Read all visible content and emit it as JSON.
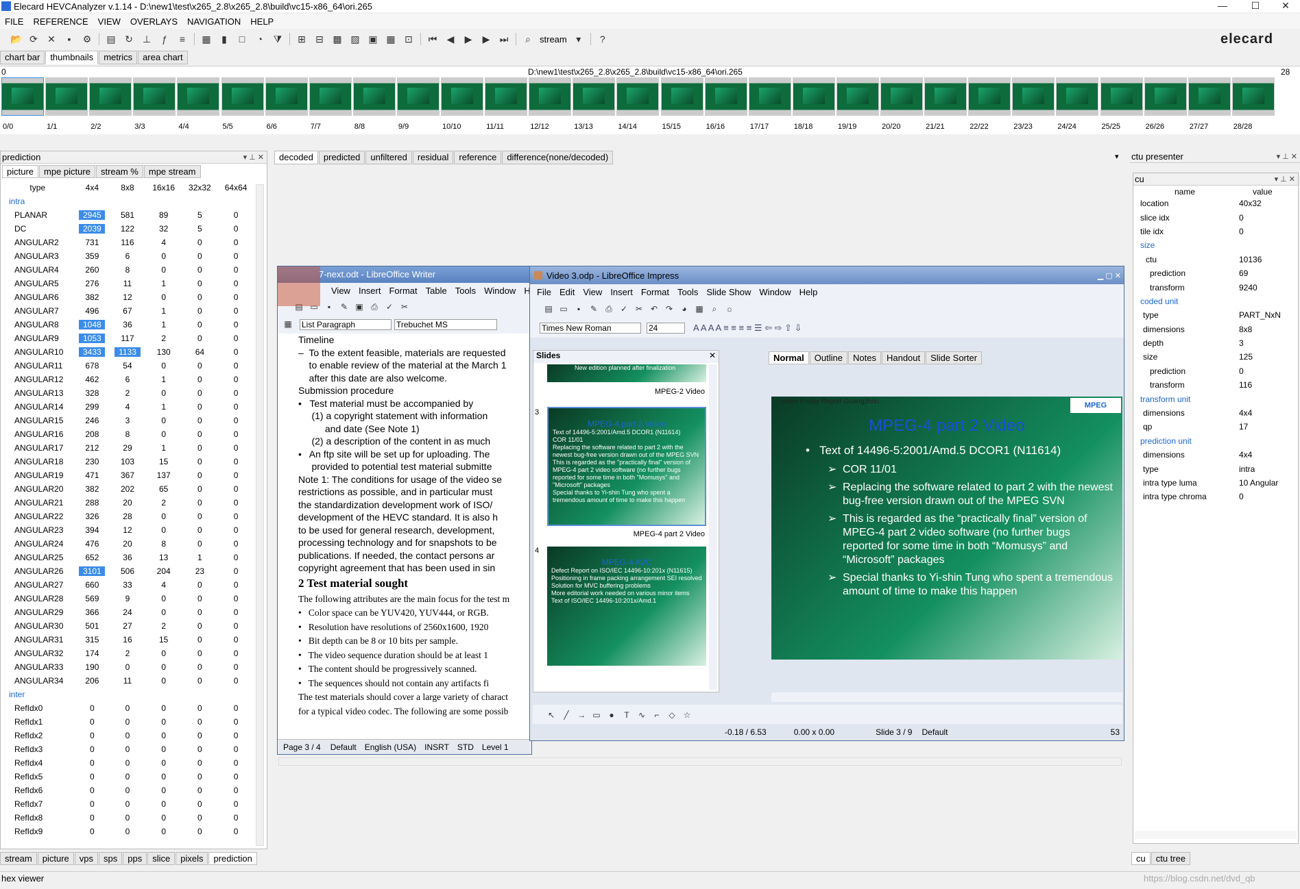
{
  "window": {
    "title": "Elecard HEVCAnalyzer v.1.14 - D:\\new1\\test\\x265_2.8\\x265_2.8\\build\\vc15-x86_64\\ori.265",
    "min": "—",
    "max": "☐",
    "close": "✕"
  },
  "menu": [
    "FILE",
    "REFERENCE",
    "VIEW",
    "OVERLAYS",
    "NAVIGATION",
    "HELP"
  ],
  "toolbar": {
    "stream_label": "stream",
    "help": "?",
    "logo": "elecard"
  },
  "viewtabs": [
    "chart bar",
    "thumbnails",
    "metrics",
    "area chart"
  ],
  "thumbs": {
    "path": "D:\\new1\\test\\x265_2.8\\x265_2.8\\build\\vc15-x86_64\\ori.265",
    "left": "0",
    "right": "28",
    "labels": [
      "0/0",
      "1/1",
      "2/2",
      "3/3",
      "4/4",
      "5/5",
      "6/6",
      "7/7",
      "8/8",
      "9/9",
      "10/10",
      "11/11",
      "12/12",
      "13/13",
      "14/14",
      "15/15",
      "16/16",
      "17/17",
      "18/18",
      "19/19",
      "20/20",
      "21/21",
      "22/22",
      "23/23",
      "24/24",
      "25/25",
      "26/26",
      "27/27",
      "28/28"
    ]
  },
  "prediction": {
    "title": "prediction",
    "tabs": [
      "picture",
      "mpe picture",
      "stream %",
      "mpe stream"
    ],
    "headers": [
      "type",
      "4x4",
      "8x8",
      "16x16",
      "32x32",
      "64x64"
    ],
    "intra_label": "intra",
    "inter_label": "inter",
    "intra": [
      [
        "PLANAR",
        "2945",
        "581",
        "89",
        "5",
        "0"
      ],
      [
        "DC",
        "2039",
        "122",
        "32",
        "5",
        "0"
      ],
      [
        "ANGULAR2",
        "731",
        "116",
        "4",
        "0",
        "0"
      ],
      [
        "ANGULAR3",
        "359",
        "6",
        "0",
        "0",
        "0"
      ],
      [
        "ANGULAR4",
        "260",
        "8",
        "0",
        "0",
        "0"
      ],
      [
        "ANGULAR5",
        "276",
        "11",
        "1",
        "0",
        "0"
      ],
      [
        "ANGULAR6",
        "382",
        "12",
        "0",
        "0",
        "0"
      ],
      [
        "ANGULAR7",
        "496",
        "67",
        "1",
        "0",
        "0"
      ],
      [
        "ANGULAR8",
        "1048",
        "36",
        "1",
        "0",
        "0"
      ],
      [
        "ANGULAR9",
        "1053",
        "117",
        "2",
        "0",
        "0"
      ],
      [
        "ANGULAR10",
        "3433",
        "1133",
        "130",
        "64",
        "0"
      ],
      [
        "ANGULAR11",
        "678",
        "54",
        "0",
        "0",
        "0"
      ],
      [
        "ANGULAR12",
        "462",
        "6",
        "1",
        "0",
        "0"
      ],
      [
        "ANGULAR13",
        "328",
        "2",
        "0",
        "0",
        "0"
      ],
      [
        "ANGULAR14",
        "299",
        "4",
        "1",
        "0",
        "0"
      ],
      [
        "ANGULAR15",
        "246",
        "3",
        "0",
        "0",
        "0"
      ],
      [
        "ANGULAR16",
        "208",
        "8",
        "0",
        "0",
        "0"
      ],
      [
        "ANGULAR17",
        "212",
        "29",
        "1",
        "0",
        "0"
      ],
      [
        "ANGULAR18",
        "230",
        "103",
        "15",
        "0",
        "0"
      ],
      [
        "ANGULAR19",
        "471",
        "367",
        "137",
        "0",
        "0"
      ],
      [
        "ANGULAR20",
        "382",
        "202",
        "65",
        "0",
        "0"
      ],
      [
        "ANGULAR21",
        "288",
        "20",
        "2",
        "0",
        "0"
      ],
      [
        "ANGULAR22",
        "326",
        "28",
        "0",
        "0",
        "0"
      ],
      [
        "ANGULAR23",
        "394",
        "12",
        "0",
        "0",
        "0"
      ],
      [
        "ANGULAR24",
        "476",
        "20",
        "8",
        "0",
        "0"
      ],
      [
        "ANGULAR25",
        "652",
        "36",
        "13",
        "1",
        "0"
      ],
      [
        "ANGULAR26",
        "3101",
        "506",
        "204",
        "23",
        "0"
      ],
      [
        "ANGULAR27",
        "660",
        "33",
        "4",
        "0",
        "0"
      ],
      [
        "ANGULAR28",
        "569",
        "9",
        "0",
        "0",
        "0"
      ],
      [
        "ANGULAR29",
        "366",
        "24",
        "0",
        "0",
        "0"
      ],
      [
        "ANGULAR30",
        "501",
        "27",
        "2",
        "0",
        "0"
      ],
      [
        "ANGULAR31",
        "315",
        "16",
        "15",
        "0",
        "0"
      ],
      [
        "ANGULAR32",
        "174",
        "2",
        "0",
        "0",
        "0"
      ],
      [
        "ANGULAR33",
        "190",
        "0",
        "0",
        "0",
        "0"
      ],
      [
        "ANGULAR34",
        "206",
        "11",
        "0",
        "0",
        "0"
      ]
    ],
    "inter": [
      [
        "RefIdx0",
        "0",
        "0",
        "0",
        "0",
        "0"
      ],
      [
        "RefIdx1",
        "0",
        "0",
        "0",
        "0",
        "0"
      ],
      [
        "RefIdx2",
        "0",
        "0",
        "0",
        "0",
        "0"
      ],
      [
        "RefIdx3",
        "0",
        "0",
        "0",
        "0",
        "0"
      ],
      [
        "RefIdx4",
        "0",
        "0",
        "0",
        "0",
        "0"
      ],
      [
        "RefIdx5",
        "0",
        "0",
        "0",
        "0",
        "0"
      ],
      [
        "RefIdx6",
        "0",
        "0",
        "0",
        "0",
        "0"
      ],
      [
        "RefIdx7",
        "0",
        "0",
        "0",
        "0",
        "0"
      ],
      [
        "RefIdx8",
        "0",
        "0",
        "0",
        "0",
        "0"
      ],
      [
        "RefIdx9",
        "0",
        "0",
        "0",
        "0",
        "0"
      ]
    ],
    "bottom_tabs": [
      "stream",
      "picture",
      "vps",
      "sps",
      "pps",
      "slice",
      "pixels",
      "prediction"
    ]
  },
  "center_tabs": [
    "decoded",
    "predicted",
    "unfiltered",
    "residual",
    "reference",
    "difference(none/decoded)"
  ],
  "ctu": {
    "title": "ctu presenter",
    "sub": "cu",
    "headers": [
      "name",
      "value"
    ],
    "rows": [
      [
        "location",
        "40x32",
        0
      ],
      [
        "slice idx",
        "0",
        0
      ],
      [
        "tile idx",
        "0",
        0
      ],
      [
        "size",
        "",
        2
      ],
      [
        "ctu",
        "10136",
        1
      ],
      [
        "prediction",
        "69",
        2
      ],
      [
        "transform",
        "9240",
        2
      ],
      [
        "coded unit",
        "",
        3
      ],
      [
        "type",
        "PART_NxN",
        1
      ],
      [
        "dimensions",
        "8x8",
        1
      ],
      [
        "depth",
        "3",
        1
      ],
      [
        "size",
        "125",
        1
      ],
      [
        "prediction",
        "0",
        2
      ],
      [
        "transform",
        "116",
        2
      ],
      [
        "transform unit",
        "",
        3
      ],
      [
        "dimensions",
        "4x4",
        1
      ],
      [
        "qp",
        "17",
        1
      ],
      [
        "prediction unit",
        "",
        3
      ],
      [
        "dimensions",
        "4x4",
        1
      ],
      [
        "type",
        "intra",
        1
      ],
      [
        "intra type luma",
        "10 Angular",
        1
      ],
      [
        "intra type chroma",
        "0",
        1
      ]
    ],
    "bottom_tabs": [
      "cu",
      "ctu tree"
    ]
  },
  "hexviewer": "hex viewer",
  "watermark": "https://blog.csdn.net/dvd_qb",
  "writer": {
    "title": "7-next.odt - LibreOffice Writer",
    "menu": [
      "View",
      "Insert",
      "Format",
      "Table",
      "Tools",
      "Window",
      "Help"
    ],
    "style": "List Paragraph",
    "font": "Trebuchet MS",
    "lines": [
      "Timeline",
      "–  To the extent feasible, materials are requested",
      "    to enable review of the material at the March 1",
      "    after this date are also welcome.",
      "Submission procedure",
      "•   Test material must be accompanied by",
      "     (1) a copyright statement with information",
      "          and date (See Note 1)",
      "     (2) a description of the content in as much",
      "•   An ftp site will be set up for uploading. The",
      "     provided to potential test material submitte",
      "Note 1: The conditions for usage of the video se",
      "restrictions as possible, and in particular must",
      "the standardization development work of ISO/",
      "development of the HEVC standard. It is also h",
      "to be used for general research, development,",
      "processing technology and for snapshots to be",
      "publications. If needed, the contact persons ar",
      "copyright agreement that has been used in sin"
    ],
    "heading": "2    Test material sought",
    "lines2": [
      "The following attributes are the main focus for the test m",
      "•   Color space can be YUV420, YUV444, or RGB.",
      "•   Resolution have resolutions of 2560x1600, 1920",
      "•   Bit depth can be 8 or 10 bits per sample.",
      "•   The video sequence duration should be at least 1",
      "•   The content should be progressively scanned.",
      "•   The sequences should not contain any artifacts fi",
      "The test materials should cover a large variety of charact",
      "for a typical video codec. The following are some possib"
    ],
    "status": [
      "Page 3 / 4",
      "Default",
      "English (USA)",
      "INSRT",
      "STD",
      "Level 1"
    ]
  },
  "impress": {
    "title": "Video 3.odp - LibreOffice Impress",
    "menu": [
      "File",
      "Edit",
      "View",
      "Insert",
      "Format",
      "Tools",
      "Slide Show",
      "Window",
      "Help"
    ],
    "font": "Times New Roman",
    "size": "24",
    "slides_label": "Slides",
    "view_tabs": [
      "Normal",
      "Outline",
      "Notes",
      "Handout",
      "Slide Sorter"
    ],
    "thumb_top_caption": "MPEG-2 Video",
    "thumb_top_text": "New edition planned after finalization",
    "s3_num": "3",
    "s3_title": "MPEG-4 part 2 Video",
    "s3_caption": "MPEG-4 part 2 Video",
    "s3_lines": [
      "Text of 14496-5:2001/Amd.5 DCOR1 (N11614)",
      "COR 11/01",
      "Replacing the software related to part 2 with the newest bug-free version drawn out of the MPEG SVN",
      "This is regarded as the \"practically final\" version of MPEG-4 part 2 video software (no further bugs reported for some time in both \"Momusys\" and \"Microsoft\" packages",
      "Special thanks to Yi-shin Tung who spent a tremendous amount of time to make this happen"
    ],
    "s4_num": "4",
    "s4_title": "MPEG-4 AVC",
    "s4_lines": [
      "Defect Report on ISO/IEC 14496-10:201x (N11615)",
      "Positioning in frame packing arrangement SEI resolved",
      "Solution for MVC buffering problems",
      "More editorial work needed on various minor items",
      "Text of ISO/IEC 14496-10:201x/Amd.1"
    ],
    "main_header": "Video Friday Report Guangzhou",
    "logo": "MPEG",
    "main_title": "MPEG-4 part 2 Video",
    "main_b1": "Text of 14496-5:2001/Amd.5 DCOR1 (N11614)",
    "main_b2": "COR 11/01",
    "main_b3": "Replacing the software related to part 2 with the newest bug-free version drawn out of the MPEG SVN",
    "main_b4": "This is regarded as the “practically final” version of MPEG-4 part 2 video software (no further bugs reported for some time in both “Momusys” and “Microsoft” packages",
    "main_b5": "Special thanks to Yi-shin Tung who spent a tremendous amount of time to make this happen",
    "status": [
      "-0.18 / 6.53",
      "0.00 x 0.00",
      "Slide 3 / 9",
      "Default",
      "53"
    ]
  }
}
